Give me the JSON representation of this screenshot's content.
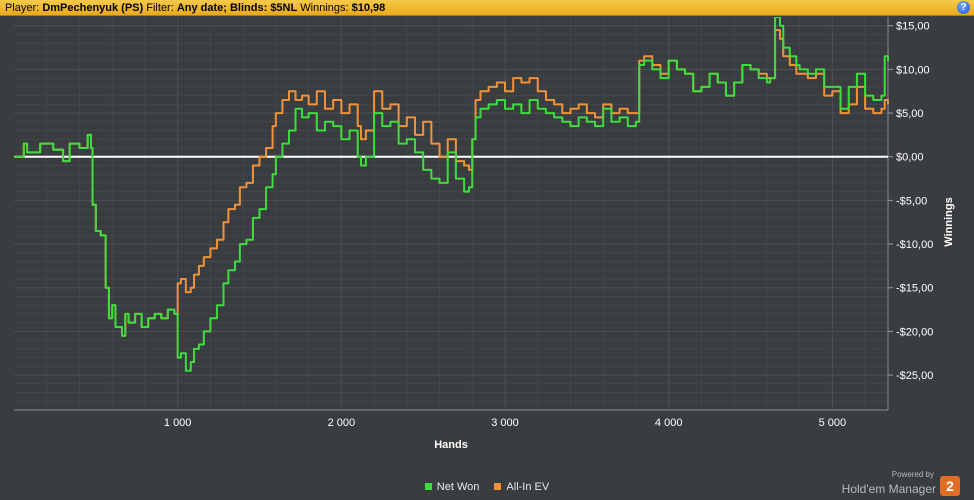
{
  "header": {
    "player_label": "Player:",
    "player_value": "DmPechenyuk (PS)",
    "filter_label": "Filter:",
    "filter_value": "Any date; Blinds: $5NL",
    "winnings_label": "Winnings:",
    "winnings_value": "$10,98",
    "help_symbol": "?"
  },
  "legend": [
    {
      "label": "Net Won",
      "color": "#3fdc3f"
    },
    {
      "label": "All-In EV",
      "color": "#f0923a"
    }
  ],
  "powered_by": {
    "line1": "Powered by",
    "line2": "Hold'em Manager",
    "badge": "2"
  },
  "colors": {
    "background": "#3a3d40",
    "grid": "#4b4f53",
    "zero_line": "#ffffff",
    "net_won": "#3fdc3f",
    "allin_ev": "#f0923a",
    "header": "#f0b52a"
  },
  "chart_data": {
    "type": "line",
    "xlabel": "Hands",
    "ylabel": "Winnings",
    "xlim": [
      0,
      5340
    ],
    "ylim": [
      -29,
      16
    ],
    "x_ticks": [
      1000,
      2000,
      3000,
      4000,
      5000
    ],
    "x_tick_labels": [
      "1 000",
      "2 000",
      "3 000",
      "4 000",
      "5 000"
    ],
    "y_ticks": [
      15,
      10,
      5,
      0,
      -5,
      -10,
      -15,
      -20,
      -25
    ],
    "y_tick_labels": [
      "$15,00",
      "$10,00",
      "$5,00",
      "$0,00",
      "-$5,00",
      "-$10,00",
      "-$15,00",
      "-$20,00",
      "-$25,00"
    ],
    "grid": true,
    "legend_position": "bottom-center",
    "series": [
      {
        "name": "Net Won",
        "x": [
          0,
          60,
          80,
          160,
          240,
          300,
          340,
          400,
          450,
          470,
          480,
          500,
          530,
          560,
          580,
          600,
          620,
          660,
          680,
          700,
          740,
          780,
          820,
          860,
          900,
          940,
          980,
          1000,
          1020,
          1050,
          1080,
          1100,
          1130,
          1160,
          1200,
          1240,
          1280,
          1310,
          1350,
          1380,
          1420,
          1460,
          1500,
          1540,
          1580,
          1600,
          1640,
          1680,
          1720,
          1760,
          1800,
          1850,
          1900,
          1950,
          2000,
          2050,
          2100,
          2120,
          2150,
          2200,
          2250,
          2300,
          2350,
          2400,
          2450,
          2500,
          2550,
          2600,
          2650,
          2700,
          2750,
          2780,
          2800,
          2820,
          2850,
          2900,
          2950,
          3000,
          3050,
          3100,
          3150,
          3200,
          3250,
          3300,
          3350,
          3400,
          3450,
          3500,
          3550,
          3600,
          3650,
          3700,
          3750,
          3800,
          3820,
          3850,
          3900,
          3950,
          4000,
          4050,
          4100,
          4150,
          4200,
          4250,
          4300,
          4350,
          4400,
          4450,
          4500,
          4550,
          4600,
          4620,
          4650,
          4680,
          4700,
          4740,
          4780,
          4800,
          4850,
          4900,
          4950,
          5000,
          5050,
          5100,
          5150,
          5200,
          5250,
          5300,
          5320,
          5340
        ],
        "y": [
          0,
          1.5,
          0.5,
          1.5,
          0.8,
          -0.5,
          1.5,
          1.0,
          2.5,
          1.0,
          -5.5,
          -8.5,
          -9.0,
          -15.0,
          -18.5,
          -17.0,
          -19.5,
          -20.5,
          -18.0,
          -19.0,
          -18.0,
          -19.5,
          -18.5,
          -18.0,
          -18.5,
          -17.5,
          -18.0,
          -23.0,
          -22.5,
          -24.5,
          -23.5,
          -22.0,
          -21.5,
          -20.0,
          -18.5,
          -17.0,
          -14.5,
          -13.0,
          -12.0,
          -10.0,
          -9.5,
          -7.0,
          -6.0,
          -3.5,
          -2.0,
          0.0,
          1.5,
          3.0,
          5.5,
          4.5,
          5.0,
          3.0,
          4.0,
          3.5,
          2.0,
          3.0,
          0.0,
          -1.0,
          0.0,
          5.0,
          3.5,
          4.0,
          1.5,
          2.0,
          0.5,
          -1.5,
          -2.5,
          -3.0,
          0.5,
          -2.5,
          -4.0,
          -3.5,
          2.0,
          4.5,
          5.5,
          6.0,
          6.5,
          5.5,
          6.0,
          5.0,
          6.5,
          5.5,
          5.0,
          4.5,
          4.0,
          3.5,
          4.5,
          4.0,
          3.5,
          5.5,
          4.0,
          4.5,
          3.5,
          4.0,
          10.5,
          11.0,
          10.0,
          9.0,
          11.0,
          10.0,
          9.5,
          7.5,
          8.0,
          9.5,
          8.5,
          7.0,
          8.5,
          10.5,
          10.0,
          9.0,
          8.5,
          9.0,
          16.0,
          15.0,
          12.5,
          11.5,
          10.5,
          10.0,
          9.5,
          10.0,
          8.0,
          8.0,
          5.5,
          8.0,
          9.5,
          7.0,
          6.5,
          7.0,
          11.5,
          10.98
        ],
        "color": "#3fdc3f"
      },
      {
        "name": "All-In EV",
        "x": [
          0,
          60,
          80,
          160,
          240,
          300,
          340,
          400,
          450,
          470,
          480,
          500,
          530,
          560,
          580,
          600,
          620,
          660,
          680,
          700,
          740,
          780,
          820,
          860,
          900,
          940,
          980,
          1000,
          1020,
          1050,
          1080,
          1100,
          1130,
          1160,
          1200,
          1240,
          1280,
          1310,
          1350,
          1380,
          1420,
          1460,
          1500,
          1540,
          1580,
          1600,
          1640,
          1680,
          1720,
          1760,
          1800,
          1850,
          1900,
          1950,
          2000,
          2050,
          2100,
          2120,
          2150,
          2200,
          2250,
          2300,
          2350,
          2400,
          2450,
          2500,
          2550,
          2600,
          2650,
          2700,
          2750,
          2780,
          2800,
          2820,
          2850,
          2900,
          2950,
          3000,
          3050,
          3100,
          3150,
          3200,
          3250,
          3300,
          3350,
          3400,
          3450,
          3500,
          3550,
          3600,
          3650,
          3700,
          3750,
          3800,
          3820,
          3850,
          3900,
          3950,
          4000,
          4050,
          4100,
          4150,
          4200,
          4250,
          4300,
          4350,
          4400,
          4450,
          4500,
          4550,
          4600,
          4620,
          4650,
          4680,
          4700,
          4740,
          4780,
          4800,
          4850,
          4900,
          4950,
          5000,
          5050,
          5100,
          5150,
          5200,
          5250,
          5300,
          5320,
          5340
        ],
        "y": [
          0,
          1.5,
          0.5,
          1.5,
          0.8,
          -0.5,
          1.5,
          1.0,
          2.5,
          1.0,
          -5.5,
          -8.5,
          -9.0,
          -15.0,
          -18.5,
          -17.0,
          -19.5,
          -20.5,
          -18.0,
          -19.0,
          -18.0,
          -19.5,
          -18.5,
          -18.0,
          -18.5,
          -17.5,
          -18.0,
          -14.5,
          -14.0,
          -15.5,
          -15.0,
          -13.5,
          -12.5,
          -11.5,
          -10.5,
          -9.5,
          -7.5,
          -6.0,
          -5.5,
          -3.5,
          -3.0,
          -1.0,
          0.0,
          1.0,
          3.5,
          5.0,
          6.5,
          7.5,
          6.5,
          7.0,
          6.0,
          7.5,
          5.5,
          6.5,
          5.0,
          6.0,
          3.5,
          2.0,
          3.0,
          7.5,
          5.5,
          6.0,
          3.5,
          4.5,
          2.5,
          4.0,
          1.5,
          0.0,
          2.0,
          -0.5,
          -1.0,
          -1.5,
          2.0,
          6.5,
          7.5,
          8.0,
          8.5,
          7.5,
          9.0,
          8.5,
          9.0,
          7.5,
          6.5,
          6.0,
          5.0,
          5.5,
          6.0,
          5.0,
          4.5,
          6.0,
          5.0,
          5.5,
          5.0,
          5.0,
          11.0,
          11.5,
          10.5,
          9.5,
          11.0,
          10.0,
          9.5,
          7.5,
          8.0,
          9.5,
          8.5,
          7.0,
          8.5,
          10.5,
          10.0,
          9.5,
          9.0,
          9.0,
          14.5,
          13.5,
          11.5,
          10.5,
          9.5,
          9.5,
          9.0,
          9.5,
          7.0,
          7.5,
          5.0,
          6.0,
          8.0,
          5.5,
          5.0,
          5.5,
          6.5,
          6.0
        ],
        "color": "#f0923a"
      }
    ]
  }
}
